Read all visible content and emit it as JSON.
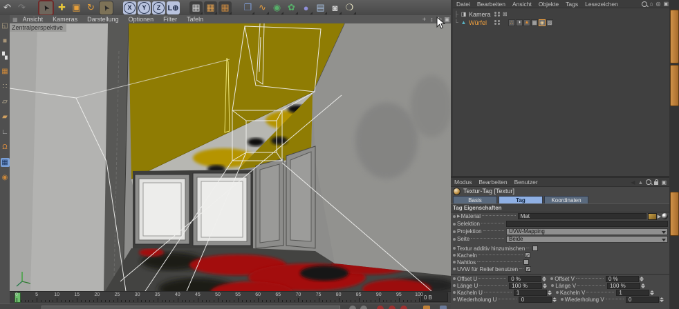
{
  "top_toolbar": {
    "tools": [
      {
        "name": "undo-icon"
      },
      {
        "name": "redo-icon"
      },
      {
        "name": "live-selection-icon"
      },
      {
        "name": "move-tool-icon"
      },
      {
        "name": "scale-tool-icon"
      },
      {
        "name": "rotate-tool-icon"
      },
      {
        "name": "selection-tool-icon"
      },
      {
        "name": "lock-x-icon",
        "letter": "X"
      },
      {
        "name": "lock-y-icon",
        "letter": "Y"
      },
      {
        "name": "lock-z-icon",
        "letter": "Z"
      },
      {
        "name": "coordinate-system-icon",
        "letter": "L"
      },
      {
        "name": "render-view-icon"
      },
      {
        "name": "render-active-icon"
      },
      {
        "name": "render-settings-icon"
      },
      {
        "name": "add-cube-icon"
      },
      {
        "name": "add-spline-icon"
      },
      {
        "name": "add-nurbs-icon"
      },
      {
        "name": "add-array-icon"
      },
      {
        "name": "add-deformer-icon"
      },
      {
        "name": "add-environment-icon"
      },
      {
        "name": "add-camera-icon"
      },
      {
        "name": "add-light-icon"
      }
    ]
  },
  "left_toolbar": {
    "tools": [
      {
        "name": "make-editable-icon"
      },
      {
        "name": "model-mode-icon"
      },
      {
        "name": "texture-mode-icon"
      },
      {
        "name": "texture-axis-mode-icon"
      },
      {
        "name": "points-mode-icon"
      },
      {
        "name": "edges-mode-icon"
      },
      {
        "name": "polygons-mode-icon"
      },
      {
        "name": "object-axis-mode-icon"
      },
      {
        "name": "magnet-snap-icon"
      },
      {
        "name": "edit-texture-mode-icon",
        "active": true
      },
      {
        "name": "texture-axis-lock-icon"
      }
    ]
  },
  "viewport": {
    "menu": [
      "Ansicht",
      "Kameras",
      "Darstellung",
      "Optionen",
      "Filter",
      "Tafeln"
    ],
    "label": "Zentralperspektive",
    "view_icons": [
      "pan-view-icon",
      "zoom-view-icon",
      "rotate-view-icon",
      "toggle-view-icon"
    ]
  },
  "timeline": {
    "tick_labels": [
      0,
      5,
      10,
      15,
      20,
      25,
      30,
      35,
      40,
      45,
      50,
      55,
      60,
      65,
      70,
      75,
      80,
      85,
      90,
      95,
      100
    ],
    "max_frame": 100,
    "current_marker": 0,
    "frame_field": "0 B"
  },
  "object_manager": {
    "menu": [
      "Datei",
      "Bearbeiten",
      "Ansicht",
      "Objekte",
      "Tags",
      "Lesezeichen"
    ],
    "menu_icons": [
      "search-icon",
      "home-icon",
      "eye-icon",
      "panel-icon"
    ],
    "objects": [
      {
        "name": "Kamera",
        "icon": "camera-object-icon",
        "selected": false,
        "tags": []
      },
      {
        "name": "Würfel",
        "icon": "polygon-object-icon",
        "selected": true,
        "tags": [
          "selection-tag-icon",
          "phong-tag-icon",
          "compositing-tag-icon",
          "uvw-tag-icon",
          "texture-tag-icon",
          "restriction-tag-icon"
        ],
        "selected_tag": "texture-tag-icon"
      }
    ]
  },
  "attribute_manager": {
    "menu": [
      "Modus",
      "Bearbeiten",
      "Benutzer"
    ],
    "menu_icons": [
      "back-icon",
      "up-icon",
      "search-icon",
      "lock-icon",
      "panel-icon"
    ],
    "title": "Textur-Tag [Textur]",
    "tabs": [
      {
        "label": "Basis",
        "active": false
      },
      {
        "label": "Tag",
        "active": true
      },
      {
        "label": "Koordinaten",
        "active": false
      }
    ],
    "section": "Tag Eigenschaften",
    "material": {
      "label": "Material",
      "value": "Mat",
      "icons": [
        "texture-preview-icon",
        "menu-arrow-icon",
        "sphere-icon"
      ]
    },
    "selektion": {
      "label": "Selektion",
      "value": ""
    },
    "projektion": {
      "label": "Projektion",
      "value": "UVW-Mapping"
    },
    "seite": {
      "label": "Seite",
      "value": "Beide"
    },
    "checkboxes": [
      {
        "label": "Textur additiv hinzumischen",
        "checked": false
      },
      {
        "label": "Kacheln",
        "checked": true
      },
      {
        "label": "Nahtlos",
        "checked": false
      },
      {
        "label": "UVW für Relief benutzen",
        "checked": true
      }
    ],
    "uv_rows": [
      {
        "left": {
          "label": "Offset U",
          "value": "0 %"
        },
        "right": {
          "label": "Offset V",
          "value": "0 %"
        }
      },
      {
        "left": {
          "label": "Länge U",
          "value": "100 %"
        },
        "right": {
          "label": "Länge V",
          "value": "100 %"
        }
      },
      {
        "left": {
          "label": "Kacheln U",
          "value": "1"
        },
        "right": {
          "label": "Kacheln V",
          "value": "1"
        }
      },
      {
        "left": {
          "label": "Wiederholung U",
          "value": "0"
        },
        "right": {
          "label": "Wiederholung V",
          "value": "0"
        }
      }
    ]
  },
  "colors": {
    "ceiling_yellow": "#8f7c03",
    "floor_red": "#a31010",
    "selected_orange": "#ef9f3e",
    "tab_active_blue": "#8fb0e4",
    "wireframe_white": "#f0f0ee"
  }
}
